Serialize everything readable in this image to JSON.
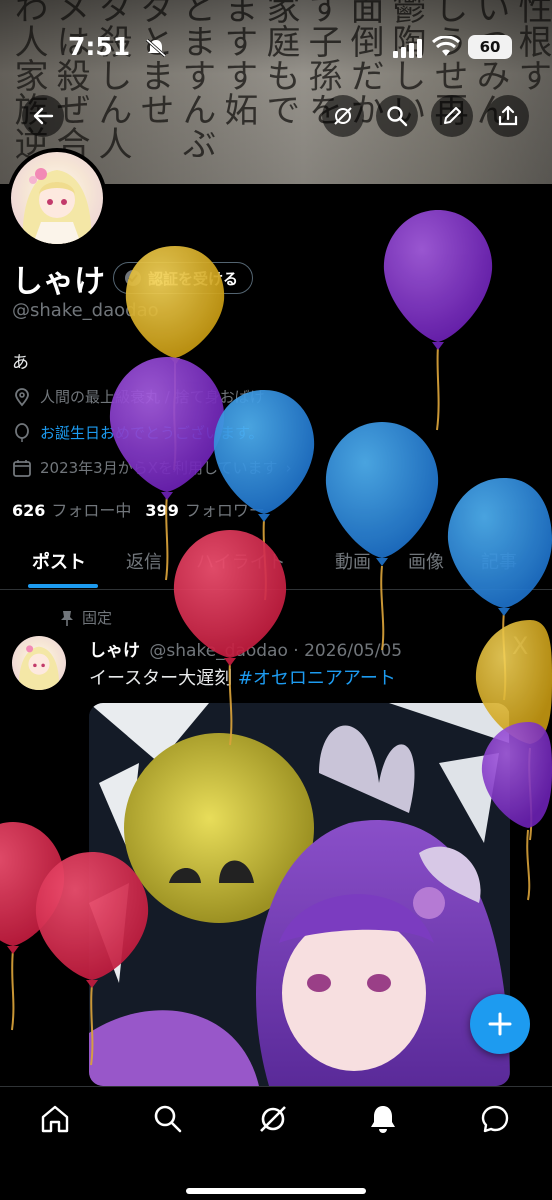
{
  "status_bar": {
    "time": "7:51",
    "battery": "60"
  },
  "profile": {
    "name": "しゃけ",
    "verify_button": "認証を受ける",
    "handle": "@shake_daodao",
    "bio": "あ",
    "location": "人間の最上級衰丸 / 捨て身おばけ",
    "birthday": "お誕生日おめでとうございます。",
    "joined": "2023年3月からXを利用しています",
    "following_count": "626",
    "following_label": "フォロー中",
    "followers_count": "399",
    "followers_label": "フォロワー"
  },
  "tabs": [
    "ポスト",
    "返信",
    "ハイライト",
    "動画",
    "画像",
    "記事"
  ],
  "post": {
    "pinned_label": "固定",
    "author_name": "しゃけ",
    "author_handle": "@shake_daodao",
    "date": "2026/05/05",
    "text": "イースター大遅刻 ",
    "hashtag": "#オセロニアアート"
  },
  "icons": [
    "back-arrow-icon",
    "grok-icon",
    "search-icon",
    "pen-icon",
    "share-icon",
    "location-icon",
    "balloon-icon",
    "calendar-icon",
    "pin-icon",
    "plus-icon",
    "home-icon",
    "explore-icon",
    "notifications-icon",
    "messages-icon"
  ],
  "colors": {
    "accent": "#1d9bf0",
    "text_secondary": "#71767b",
    "background": "#000000"
  }
}
